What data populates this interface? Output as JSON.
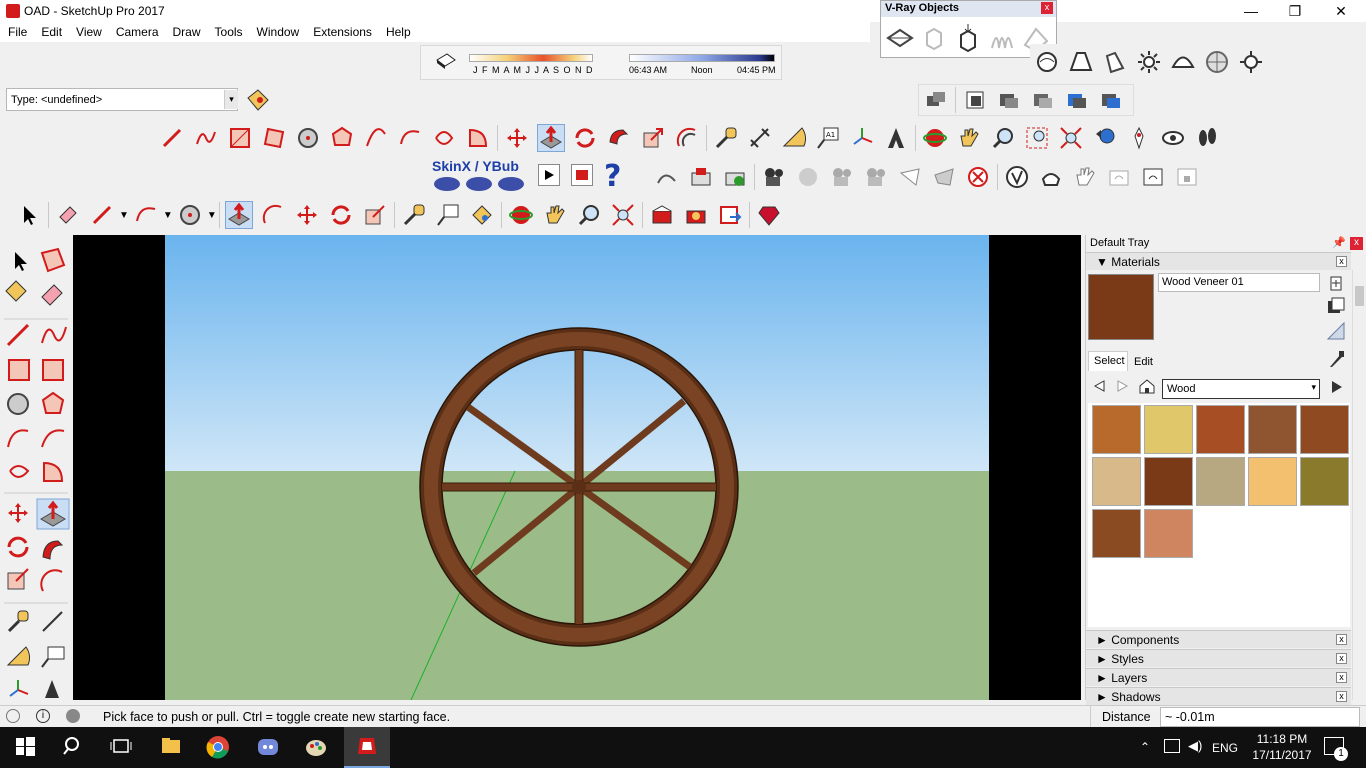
{
  "window": {
    "title": "OAD - SketchUp Pro 2017",
    "minimize": "—",
    "maximize": "❐",
    "close": "✕"
  },
  "menu": [
    "File",
    "Edit",
    "View",
    "Camera",
    "Draw",
    "Tools",
    "Window",
    "Extensions",
    "Help"
  ],
  "shadows": {
    "months": "J F M A M J J A S O N D",
    "time_start": "06:43 AM",
    "time_mid": "Noon",
    "time_end": "04:45 PM"
  },
  "vray": {
    "title": "V-Ray Objects",
    "close": "x"
  },
  "type_field": {
    "value": "Type: <undefined>"
  },
  "skinx": {
    "label": "SkinX / YBub"
  },
  "tray": {
    "title": "Default Tray",
    "materials_header": "Materials",
    "material_name": "Wood Veneer 01",
    "tab_select": "Select",
    "tab_edit": "Edit",
    "library": "Wood",
    "swatches": [
      "#b86a2c",
      "#e0c76a",
      "#a84e24",
      "#8e5530",
      "#8f4a22",
      "#d7b98a",
      "#7a3a18",
      "#b8a881",
      "#f2c06e",
      "#8a7a2c",
      "#8a4a22",
      "#cf8560"
    ],
    "panels": [
      "Components",
      "Styles",
      "Layers",
      "Shadows"
    ]
  },
  "status": {
    "hint": "Pick face to push or pull.  Ctrl = toggle create new starting face.",
    "distance_label": "Distance",
    "distance_value": "~ -0.01m"
  },
  "taskbar": {
    "language": "ENG",
    "time": "11:18 PM",
    "date": "17/11/2017",
    "notification_count": "1"
  },
  "colors": {
    "sky": "#74b9ef",
    "ground": "#9bbc88",
    "wood": "#6e3b1f",
    "accent_red": "#d21b1b"
  }
}
